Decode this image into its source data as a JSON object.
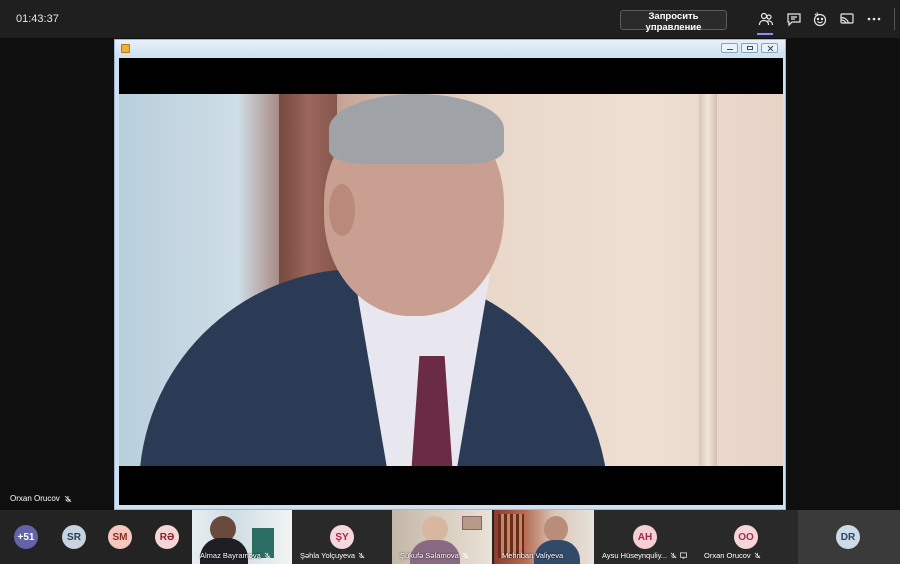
{
  "topbar": {
    "timer": "01:43:37",
    "request_control_label": "Запросить управление",
    "icons": [
      "participants-icon",
      "chat-icon",
      "reactions-icon",
      "share-icon",
      "more-icon"
    ]
  },
  "stage": {
    "presenter_name": "Orxan Orucov"
  },
  "participants": [
    {
      "initials": "+51",
      "bg": "#6264a7",
      "fg": "#ffffff"
    },
    {
      "initials": "SR",
      "bg": "#c7d3e0",
      "fg": "#2c3e55"
    },
    {
      "initials": "SM",
      "bg": "#f4c8bf",
      "fg": "#8a2f1d"
    },
    {
      "initials": "RƏ",
      "bg": "#f5d5d5",
      "fg": "#8a1f2a"
    },
    {
      "name": "Almaz Bayramova"
    },
    {
      "initials": "ŞY",
      "bg": "#f7d7dd",
      "fg": "#a02844",
      "name": "Şəhla Yolçuyeva"
    },
    {
      "name": "Şükufə Səlamova"
    },
    {
      "name": "Mehriban Valiyeva"
    },
    {
      "initials": "AH",
      "bg": "#f6cfd6",
      "fg": "#9d2941",
      "name": "Aysu Hüseynquliy..."
    },
    {
      "initials": "OO",
      "bg": "#f6d6da",
      "fg": "#a43046",
      "name": "Orxan Orucov"
    },
    {
      "initials": "DR",
      "bg": "#cddbe6",
      "fg": "#2b4560"
    }
  ]
}
